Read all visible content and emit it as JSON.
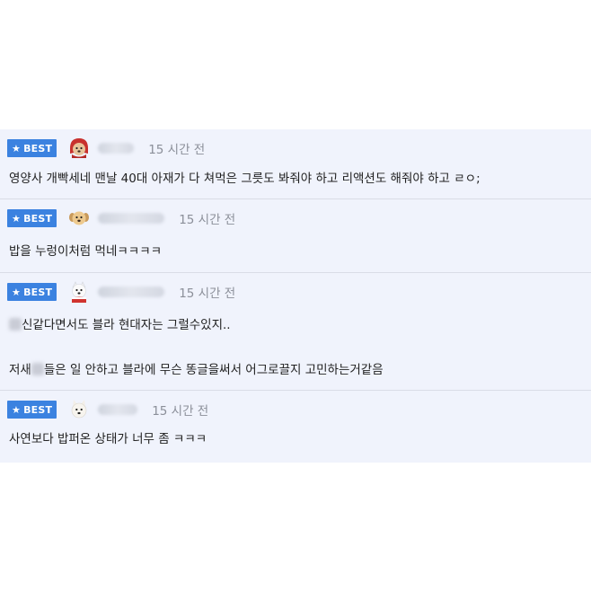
{
  "badge_label": "BEST",
  "colors": {
    "badge": "#3b82e0",
    "panel": "#f0f3fc",
    "time": "#8b8f99"
  },
  "comments": [
    {
      "avatar_icon": "red-hooded-puppy-icon",
      "time": "15 시간 전",
      "text": "영양사 개빡세네 맨날 40대 아재가 다 쳐먹은 그릇도 봐줘야 하고 리액션도 해줘야 하고 ㄹㅇ;"
    },
    {
      "avatar_icon": "puppy-icon",
      "time": "15 시간 전",
      "text": "밥을 누렁이처럼 먹네ㅋㅋㅋㅋ"
    },
    {
      "avatar_icon": "white-dog-santa-icon",
      "time": "15 시간 전",
      "text_line1": "신같다면서도 블라 현대자는 그럴수있지..",
      "text_line2_a": "저새",
      "text_line2_b": "들은 일 안하고 블라에 무슨 똥글을써서 어그로끌지 고민하는거같음"
    },
    {
      "avatar_icon": "white-fluffy-dog-icon",
      "time": "15 시간 전",
      "text": "사연보다 밥퍼온 상태가 너무 좀 ㅋㅋㅋ"
    }
  ]
}
